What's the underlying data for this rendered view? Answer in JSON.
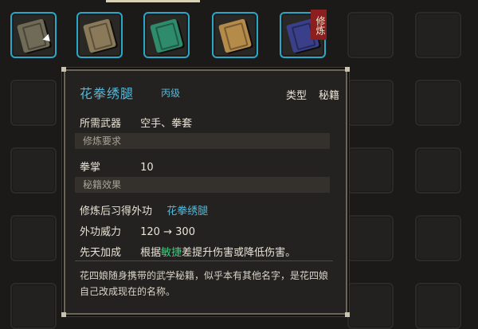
{
  "book": {
    "name": "花拳绣腿",
    "grade": "丙级",
    "type_label": "类型",
    "type_value": "秘籍",
    "weapon_label": "所需武器",
    "weapon_value": "空手、拳套",
    "section_requirements": "修炼要求",
    "req_label": "拳掌",
    "req_value": "10",
    "section_effects": "秘籍效果",
    "learn_label": "修炼后习得外功",
    "learn_value": "花拳绣腿",
    "power_label": "外功威力",
    "power_from": "120",
    "power_arrow": "→",
    "power_to": "300",
    "innate_label": "先天加成",
    "innate_pre": "根据",
    "innate_hl": "敏捷",
    "innate_post": "差提升伤害或降低伤害。",
    "description": "花四娘随身携带的武学秘籍，似乎本有其他名字，是花四娘自己改成现在的名称。"
  },
  "inventory": {
    "slot5_badge": "修炼",
    "icons": [
      "book-icon-gray",
      "book-icon-tan",
      "book-icon-green",
      "book-icon-gold",
      "book-icon-blue"
    ],
    "icon_colors": [
      "#6f6b57",
      "#8a7a5a",
      "#2e8b6b",
      "#b58b4a",
      "#3a3f8a"
    ]
  }
}
